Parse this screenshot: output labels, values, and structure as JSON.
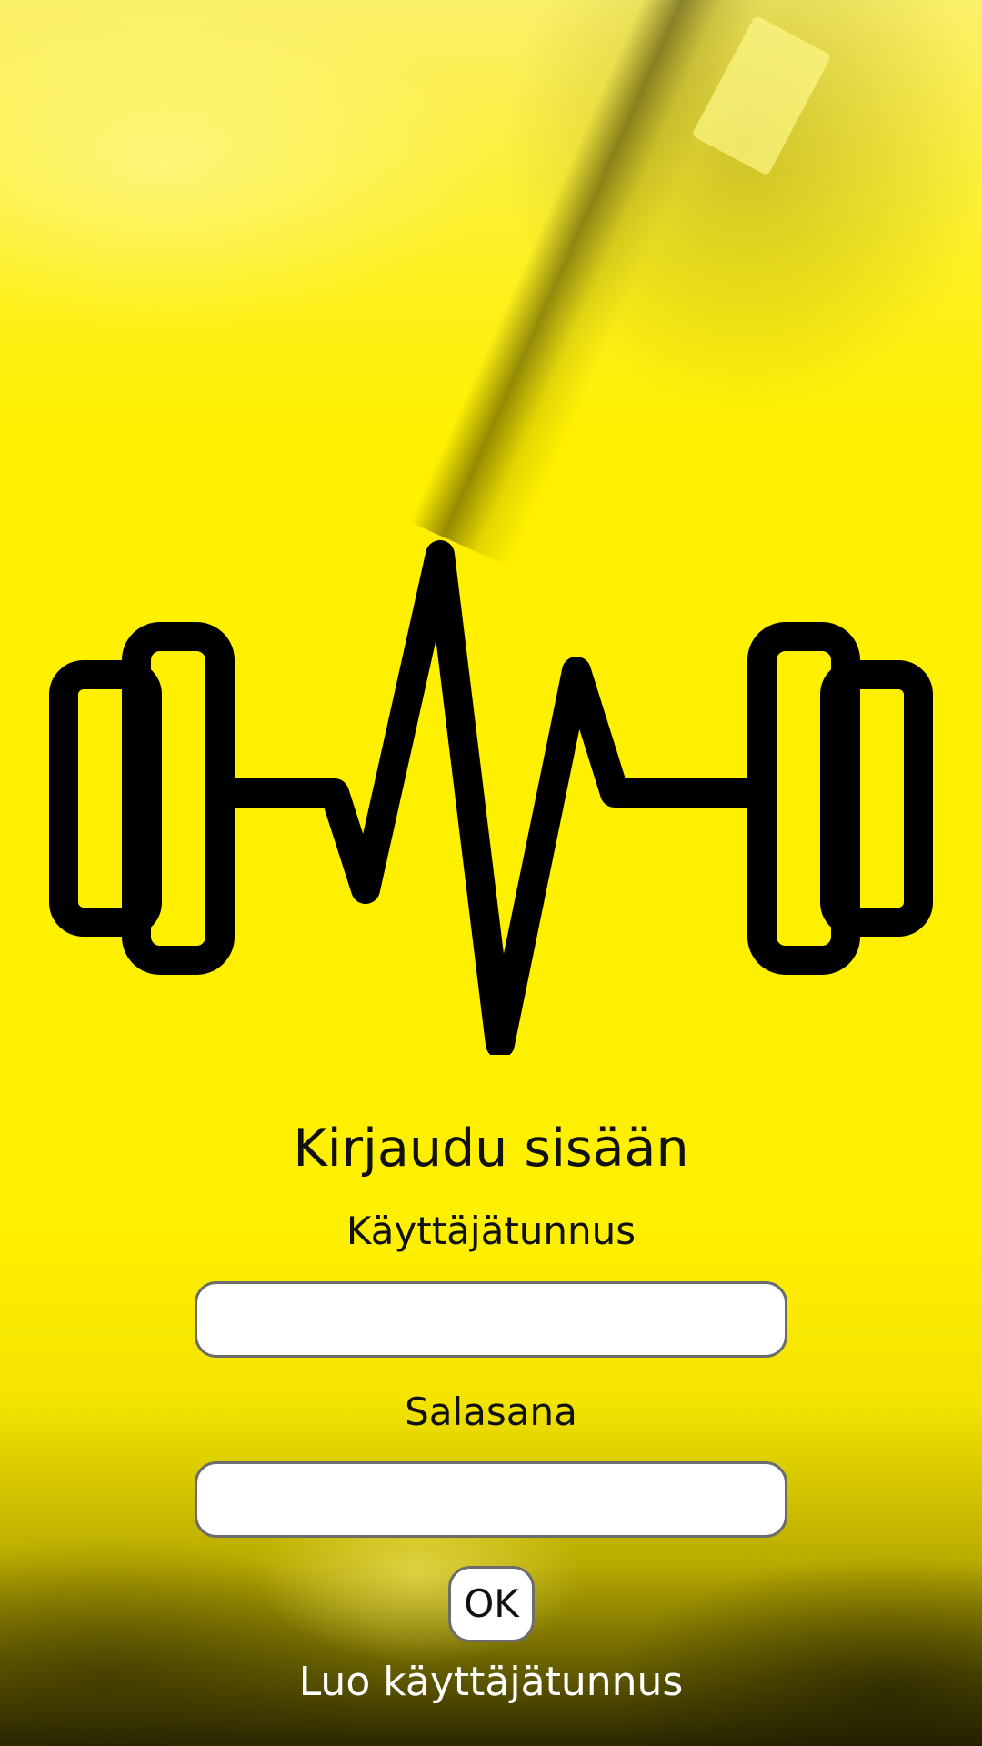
{
  "app": {
    "theme_color": "#fff200",
    "logo_icon": "dumbbell-heartbeat-icon"
  },
  "login": {
    "title": "Kirjaudu sisään",
    "username_label": "Käyttäjätunnus",
    "username_value": "",
    "password_label": "Salasana",
    "password_value": "",
    "ok_label": "OK",
    "create_account_label": "Luo käyttäjätunnus"
  }
}
